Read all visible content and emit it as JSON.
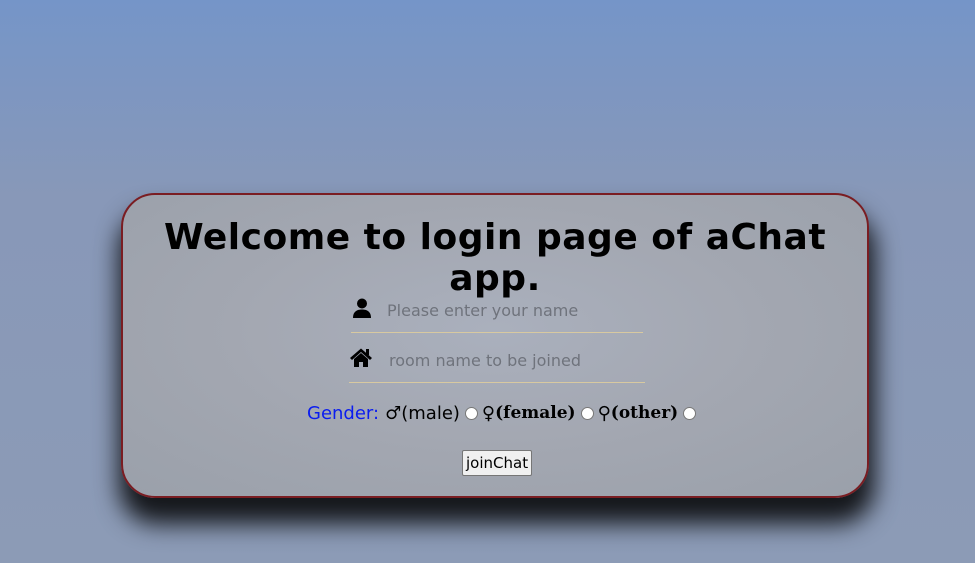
{
  "title": "Welcome to login page of aChat app.",
  "name_field": {
    "icon": "user-icon",
    "value": "",
    "placeholder": "Please enter your name"
  },
  "room_field": {
    "icon": "home-icon",
    "value": "",
    "placeholder": "room name to be joined"
  },
  "gender": {
    "label": "Gender:",
    "options": [
      {
        "symbol": "♂",
        "label": "(male)"
      },
      {
        "symbol": "♀",
        "label": "(female)"
      },
      {
        "symbol": "⚲",
        "label": "(other)"
      }
    ]
  },
  "join_button": {
    "label": "joinChat"
  },
  "colors": {
    "card_border": "#7a1d22",
    "gender_label": "#0a1cf0",
    "field_underline": "#d8c9a0"
  }
}
